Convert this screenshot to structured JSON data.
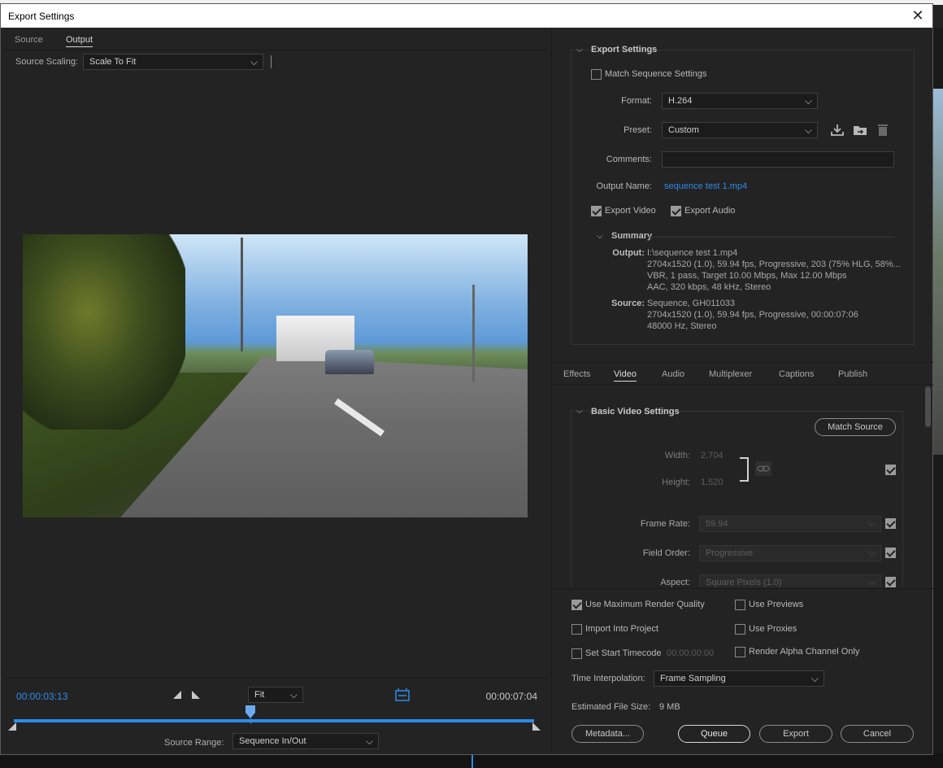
{
  "window": {
    "title": "Export Settings"
  },
  "left": {
    "tabs": [
      {
        "label": "Source"
      },
      {
        "label": "Output"
      }
    ],
    "active_tab": "Output",
    "source_scaling": {
      "label": "Source Scaling:",
      "value": "Scale To Fit"
    },
    "timeline": {
      "current_timecode": "00:00:03:13",
      "end_timecode": "00:00:07:04",
      "zoom": "Fit",
      "source_range_label": "Source Range:",
      "source_range_value": "Sequence In/Out"
    }
  },
  "export": {
    "section_title": "Export Settings",
    "match_sequence_label": "Match Sequence Settings",
    "format_label": "Format:",
    "format_value": "H.264",
    "preset_label": "Preset:",
    "preset_value": "Custom",
    "comments_label": "Comments:",
    "output_name_label": "Output Name:",
    "output_name_value": "sequence test 1.mp4",
    "export_video_label": "Export Video",
    "export_audio_label": "Export Audio",
    "summary": {
      "title": "Summary",
      "output_key": "Output:",
      "output_lines": [
        "I:\\sequence test 1.mp4",
        "2704x1520 (1.0), 59.94 fps, Progressive, 203 (75% HLG, 58%...",
        "VBR, 1 pass, Target 10.00 Mbps, Max 12.00 Mbps",
        "AAC, 320 kbps, 48 kHz, Stereo"
      ],
      "source_key": "Source:",
      "source_lines": [
        "Sequence, GH011033",
        "2704x1520 (1.0), 59.94 fps, Progressive, 00:00:07:06",
        "48000 Hz, Stereo"
      ]
    }
  },
  "tabs": [
    {
      "label": "Effects"
    },
    {
      "label": "Video"
    },
    {
      "label": "Audio"
    },
    {
      "label": "Multiplexer"
    },
    {
      "label": "Captions"
    },
    {
      "label": "Publish"
    }
  ],
  "video": {
    "section_title": "Basic Video Settings",
    "match_source_label": "Match Source",
    "width_label": "Width:",
    "width_value": "2,704",
    "height_label": "Height:",
    "height_value": "1,520",
    "frame_rate_label": "Frame Rate:",
    "frame_rate_value": "59.94",
    "field_order_label": "Field Order:",
    "field_order_value": "Progressive",
    "aspect_label": "Aspect:",
    "aspect_value": "Square Pixels (1.0)"
  },
  "bottom": {
    "use_max_render_quality": "Use Maximum Render Quality",
    "use_previews": "Use Previews",
    "import_into_project": "Import Into Project",
    "use_proxies": "Use Proxies",
    "set_start_timecode": "Set Start Timecode",
    "start_timecode_value": "00:00:00:00",
    "render_alpha": "Render Alpha Channel Only",
    "time_interpolation_label": "Time Interpolation:",
    "time_interpolation_value": "Frame Sampling",
    "estimated_size_label": "Estimated File Size:",
    "estimated_size_value": "9 MB",
    "metadata_button": "Metadata...",
    "queue_button": "Queue",
    "export_button": "Export",
    "cancel_button": "Cancel"
  },
  "colors": {
    "accent": "#2d8ceb",
    "panel": "#232323",
    "field": "#1b1b1b"
  }
}
